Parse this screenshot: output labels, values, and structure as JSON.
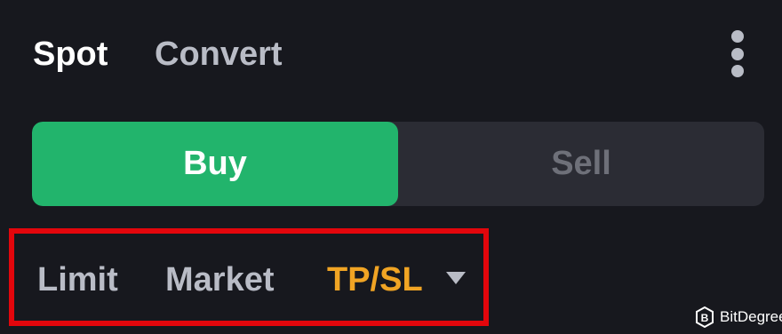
{
  "header": {
    "tabs": [
      {
        "label": "Spot",
        "active": true
      },
      {
        "label": "Convert",
        "active": false
      }
    ],
    "more_icon": "vertical-ellipsis-icon"
  },
  "side_toggle": {
    "buy_label": "Buy",
    "sell_label": "Sell",
    "selected": "Buy",
    "buy_color": "#22b46c"
  },
  "order_types": {
    "items": [
      {
        "label": "Limit",
        "active": false
      },
      {
        "label": "Market",
        "active": false
      },
      {
        "label": "TP/SL",
        "active": true
      }
    ],
    "dropdown_icon": "caret-down-icon",
    "active_color": "#f0a424",
    "highlight_color": "#e3060c"
  },
  "watermark": {
    "text": "BitDegree",
    "icon": "bitdegree-logo-icon"
  }
}
